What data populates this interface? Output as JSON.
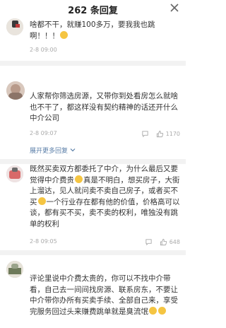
{
  "header": {
    "title": "262 条回复"
  },
  "comments": [
    {
      "text_before": "啥都不干，就赚100多万，要我我也跳啊！！！",
      "time": "2-8 09:00",
      "likes": "",
      "replies": ""
    },
    {
      "text": "人家帮你筛选房源，又带你到处看房怎么就啥也不干了，都这样没有契约精神的话还开什么中介公司",
      "time": "2-8 09:07",
      "likes": "1170",
      "replies": "展开更多回复"
    },
    {
      "text_before": "既然买卖双方都委托了中介，为什么最后又要觉得中介费贵",
      "text_mid1": "真是不明白，想买房子，大街上溜达，见人就问卖不卖自己房子，或者买不买",
      "text_mid2": "一个行业存在都有他的价值，价格高可以谈，都有买不买，卖不卖的权利，唯独没有跳单的权利",
      "time": "2-8 09:05",
      "likes": "648",
      "replies": ""
    },
    {
      "text_before": "评论里说中介费太贵的，你可以不找中介带看，自己去一间间找房源、联系房东，不要让中介带你办所有买卖手续、全部自己来，享受完服务回过头来赚费跳单就是臭流氓",
      "time": "",
      "likes": "",
      "replies": ""
    }
  ]
}
